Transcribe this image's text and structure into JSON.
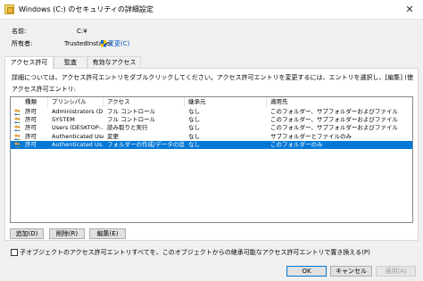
{
  "window": {
    "title": "Windows (C:) のセキュリティの詳細設定",
    "close_glyph": "✕"
  },
  "info": {
    "name_label": "名前:",
    "name_value": "C:¥",
    "owner_label": "所有者:",
    "owner_value": "TrustedInstaller",
    "change_link": "変更(C)"
  },
  "tabs": [
    {
      "label": "アクセス許可"
    },
    {
      "label": "監査"
    },
    {
      "label": "有効なアクセス"
    }
  ],
  "description": "詳細については、アクセス許可エントリをダブルクリックしてください。アクセス許可エントリを変更するには、エントリを選択し、[編集] (使用できる場合) をクリックします。",
  "list_label": "アクセス許可エントリ:",
  "columns": [
    "種類",
    "プリンシパル",
    "アクセス",
    "継承元",
    "適用先"
  ],
  "rows": [
    {
      "type": "許可",
      "principal": "Administrators (D...",
      "access": "フル コントロール",
      "inherited": "なし",
      "applies": "このフォルダー、サブフォルダーおよびファイル"
    },
    {
      "type": "許可",
      "principal": "SYSTEM",
      "access": "フル コントロール",
      "inherited": "なし",
      "applies": "このフォルダー、サブフォルダーおよびファイル"
    },
    {
      "type": "許可",
      "principal": "Users (DESKTOP-...",
      "access": "読み取りと実行",
      "inherited": "なし",
      "applies": "このフォルダー、サブフォルダーおよびファイル"
    },
    {
      "type": "許可",
      "principal": "Authenticated Use...",
      "access": "変更",
      "inherited": "なし",
      "applies": "サブフォルダーとファイルのみ"
    },
    {
      "type": "許可",
      "principal": "Authenticated Us...",
      "access": "フォルダーの作成/データの追加",
      "inherited": "なし",
      "applies": "このフォルダーのみ"
    }
  ],
  "selected_row": 4,
  "buttons": {
    "add": "追加(D)",
    "remove": "削除(R)",
    "edit": "編集(E)",
    "ok": "OK",
    "cancel": "キャンセル",
    "apply": "適用(A)"
  },
  "checkbox_label": "子オブジェクトのアクセス許可エントリすべてを、このオブジェクトからの継承可能なアクセス許可エントリで置き換える(P)",
  "colors": {
    "accent": "#0078d7",
    "link": "#0050c8"
  }
}
